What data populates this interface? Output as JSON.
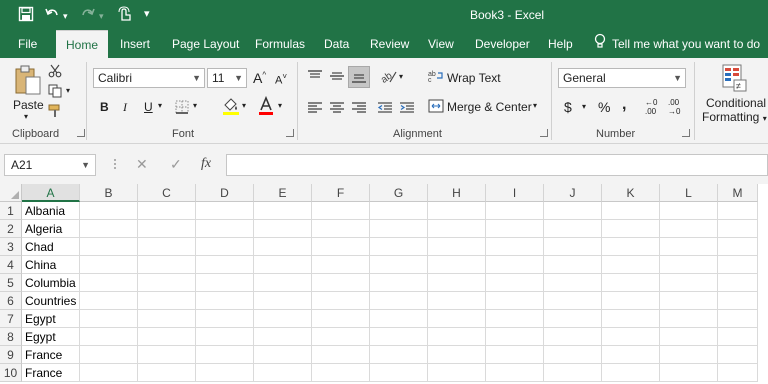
{
  "app": {
    "window_title": "Book3  -  Excel"
  },
  "ribbon_tabs": [
    "File",
    "Home",
    "Insert",
    "Page Layout",
    "Formulas",
    "Data",
    "Review",
    "View",
    "Developer",
    "Help"
  ],
  "active_tab": "Home",
  "tell_me": "Tell me what you want to do",
  "clipboard": {
    "paste_label": "Paste",
    "group_label": "Clipboard"
  },
  "font": {
    "name": "Calibri",
    "size": "11",
    "group_label": "Font",
    "fill_color": "#FFFF00",
    "font_color": "#FF0000",
    "bold_label": "B",
    "italic_label": "I",
    "underline_label": "U",
    "grow_label": "A",
    "shrink_label": "A"
  },
  "alignment": {
    "wrap_text_label": "Wrap Text",
    "merge_center_label": "Merge & Center",
    "group_label": "Alignment"
  },
  "number": {
    "format": "General",
    "group_label": "Number",
    "currency_symbol": "$",
    "percent_symbol": "%",
    "comma_symbol": "̩,",
    "inc_decimal_label": ".00",
    "dec_decimal_label": ".00"
  },
  "styles": {
    "conditional_formatting_line1": "Conditional",
    "conditional_formatting_line2": "Formatting"
  },
  "formula_bar": {
    "name_box": "A21",
    "fx_label": "fx",
    "cancel_label": "✕",
    "enter_label": "✓",
    "formula": ""
  },
  "sheet": {
    "columns": [
      "A",
      "B",
      "C",
      "D",
      "E",
      "F",
      "G",
      "H",
      "I",
      "J",
      "K",
      "L",
      "M"
    ],
    "selected_column": "A",
    "rows": [
      {
        "num": "1",
        "a": "Albania"
      },
      {
        "num": "2",
        "a": "Algeria"
      },
      {
        "num": "3",
        "a": "Chad"
      },
      {
        "num": "4",
        "a": "China"
      },
      {
        "num": "5",
        "a": "Columbia"
      },
      {
        "num": "6",
        "a": "Countries"
      },
      {
        "num": "7",
        "a": "Egypt"
      },
      {
        "num": "8",
        "a": "Egypt"
      },
      {
        "num": "9",
        "a": "France"
      },
      {
        "num": "10",
        "a": "France"
      }
    ]
  },
  "colors": {
    "brand_green": "#217346",
    "ribbon_bg": "#F3F3F3"
  }
}
